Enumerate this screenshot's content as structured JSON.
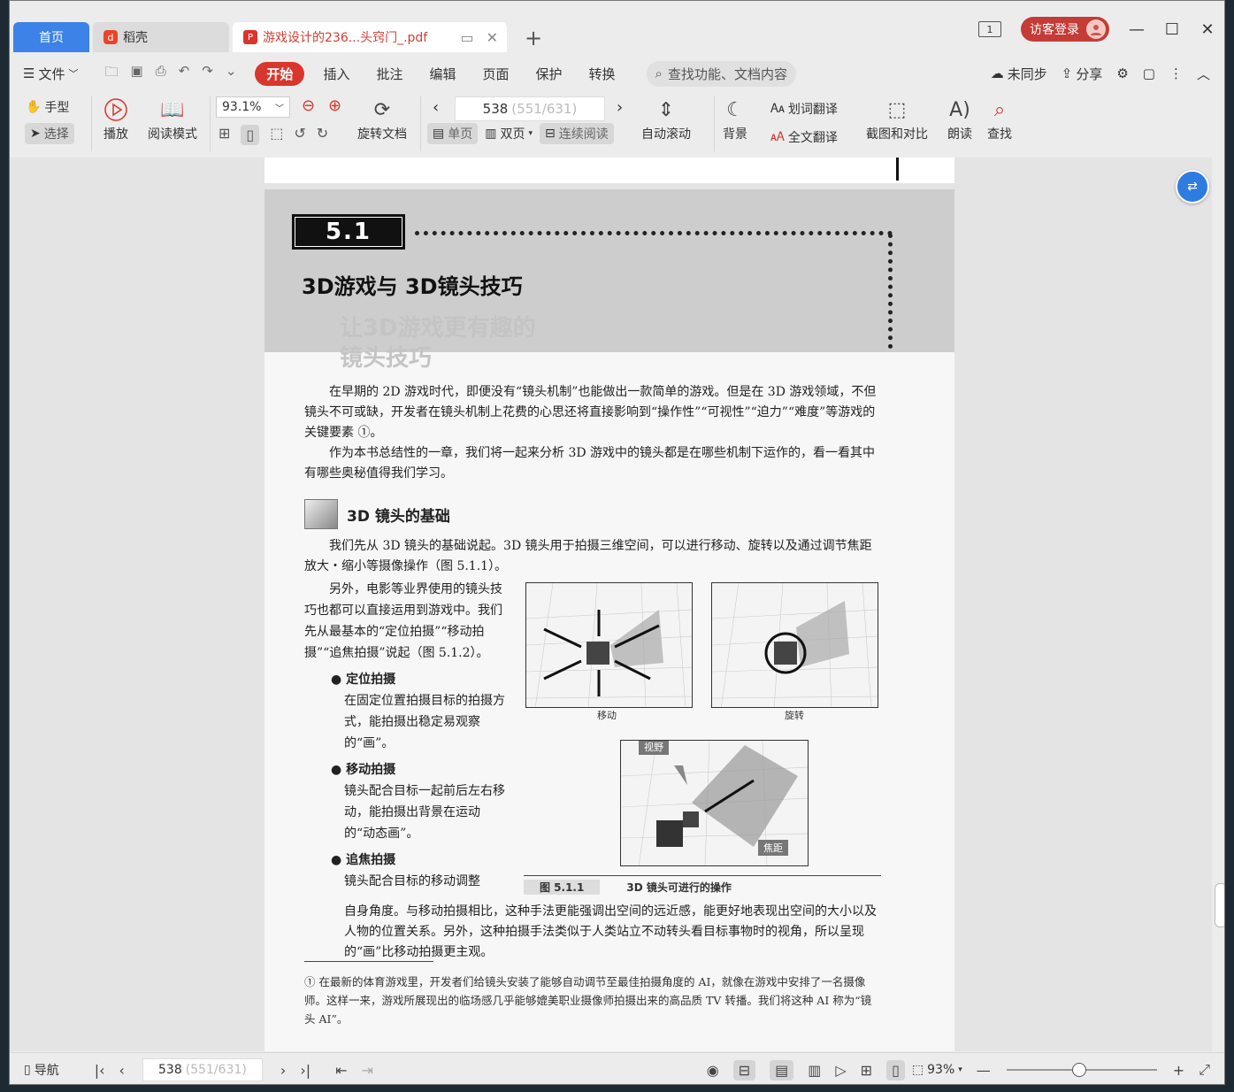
{
  "tabs": {
    "home": "首页",
    "daoke": "稻壳",
    "pdf": "游戏设计的236...头窍门_.pdf"
  },
  "topbar": {
    "badge": "1",
    "login": "访客登录"
  },
  "menu": {
    "file": "文件",
    "items": [
      "开始",
      "插入",
      "批注",
      "编辑",
      "页面",
      "保护",
      "转换"
    ],
    "search_placeholder": "查找功能、文档内容",
    "sync": "未同步",
    "share": "分享"
  },
  "ribbon": {
    "hand": "手型",
    "select": "选择",
    "play": "播放",
    "reading_mode": "阅读模式",
    "zoom": "93.1%",
    "rotate": "旋转文档",
    "page_current": "538",
    "page_total": "(551/631)",
    "single": "单页",
    "double": "双页",
    "continuous": "连续阅读",
    "auto_scroll": "自动滚动",
    "background": "背景",
    "word_translate": "划词翻译",
    "full_translate": "全文翻译",
    "screenshot": "截图和对比",
    "read_aloud": "朗读",
    "find": "查找"
  },
  "document": {
    "section_number": "5.1",
    "section_title": "3D游戏与 3D镜头技巧",
    "ghost_text_1": "让3D游戏更有趣的",
    "ghost_text_2": "镜头技巧",
    "para1": "在早期的 2D 游戏时代，即便没有“镜头机制”也能做出一款简单的游戏。但是在 3D 游戏领域，不但镜头不可或缺，开发者在镜头机制上花费的心思还将直接影响到“操作性”“可视性”“迫力”“难度”等游戏的关键要素 ①。",
    "para2": "作为本书总结性的一章，我们将一起来分析 3D 游戏中的镜头都是在哪些机制下运作的，看一看其中有哪些奥秘值得我们学习。",
    "subhead": "3D 镜头的基础",
    "para3": "我们先从 3D 镜头的基础说起。3D 镜头用于拍摄三维空间，可以进行移动、旋转以及通过调节焦距放大・缩小等摄像操作（图 5.1.1）。",
    "para4": "另外，电影等业界使用的镜头技巧也都可以直接运用到游戏中。我们先从最基本的“定位拍摄”“移动拍摄”“追焦拍摄”说起（图 5.1.2）。",
    "bullets": [
      {
        "title": "定位拍摄",
        "body": "在固定位置拍摄目标的拍摄方式，能拍摄出稳定易观察的“画”。"
      },
      {
        "title": "移动拍摄",
        "body": "镜头配合目标一起前后左右移动，能拍摄出背景在运动的“动态画”。"
      },
      {
        "title": "追焦拍摄",
        "body": "镜头配合目标的移动调整"
      }
    ],
    "para5": "自身角度。与移动拍摄相比，这种手法更能强调出空间的远近感，能更好地表现出空间的大小以及人物的位置关系。另外，这种拍摄手法类似于人类站立不动转头看目标事物时的视角，所以呈现的“画”比移动拍摄更主观。",
    "fig_move": "移动",
    "fig_rotate": "旋转",
    "fig_view": "视野",
    "fig_focus": "焦距",
    "caption_num": "图 5.1.1",
    "caption_text": "3D 镜头可进行的操作",
    "footnote": "① 在最新的体育游戏里，开发者们给镜头安装了能够自动调节至最佳拍摄角度的 AI，就像在游戏中安排了一名摄像师。这样一来，游戏所展现出的临场感几乎能够媲美职业摄像师拍摄出来的高品质 TV 转播。我们将这种 AI 称为“镜头 AI”。"
  },
  "statusbar": {
    "nav": "导航",
    "page_current": "538",
    "page_total": "(551/631)",
    "zoom": "93%"
  }
}
